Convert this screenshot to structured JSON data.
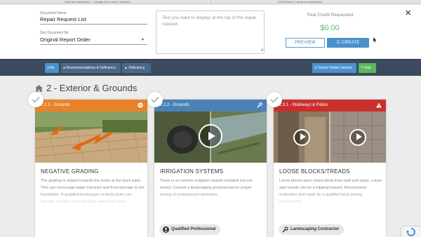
{
  "browser": {
    "tab1": "Sparrow Inspections – Chicago Area Home Inspector",
    "tab2": "1234 Main st. | sparrow-inspections"
  },
  "form": {
    "document_name_label": "Document Name",
    "document_name_value": "Repair Request List",
    "sort_label": "Sort Document By",
    "sort_value": "Original Report Order",
    "textarea_placeholder": "Text you want to display at the top of the repair request.",
    "total_credit_label": "Total Credit Requested",
    "total_credit_value": "$0.00",
    "preview_label": "PREVIEW",
    "create_label": "CREATE"
  },
  "toolbar": {
    "all_label": "All",
    "recommendations_label": "Recommendations & Deficiency",
    "deficiency_label": "Deficiency",
    "select_visible_label": "Select Visible Defects",
    "help_label": "Help"
  },
  "section": {
    "title": "2 - Exterior & Grounds"
  },
  "cards": [
    {
      "header": "2.1.1 - Grounds",
      "color": "#e8832a",
      "icon": "minus-circle-icon",
      "title": "NEGATIVE GRADING",
      "description": "The grading is sloped towards the home at the back patio. This can encourage water intrusion and frost damage to the foundation. A qualified landscaper or brick paver can regrade so water naturally flows away from home."
    },
    {
      "header": "2.1.2 - Grounds",
      "color": "#4a82b8",
      "icon": "wrench-icon",
      "title": "IRRIGATION SYSTEMS",
      "description": "There is an exterior irrigation system installed but not tested. Consult a landscaping professional for proper testing of underground sprinklers.",
      "professional": "Qualified Professional"
    },
    {
      "header": "2.3.1 - Walkways & Patios",
      "color": "#c9302c",
      "icon": "warning-icon",
      "title": "LOOSE BLOCKS/TREADS",
      "description": "Loose blocks were noted along knee wall and steps. Loose stair treads can be a tripping hazard. Recommend evaluation and repair by a qualified brick paving professional.",
      "professional": "Landscaping Contractor"
    }
  ]
}
